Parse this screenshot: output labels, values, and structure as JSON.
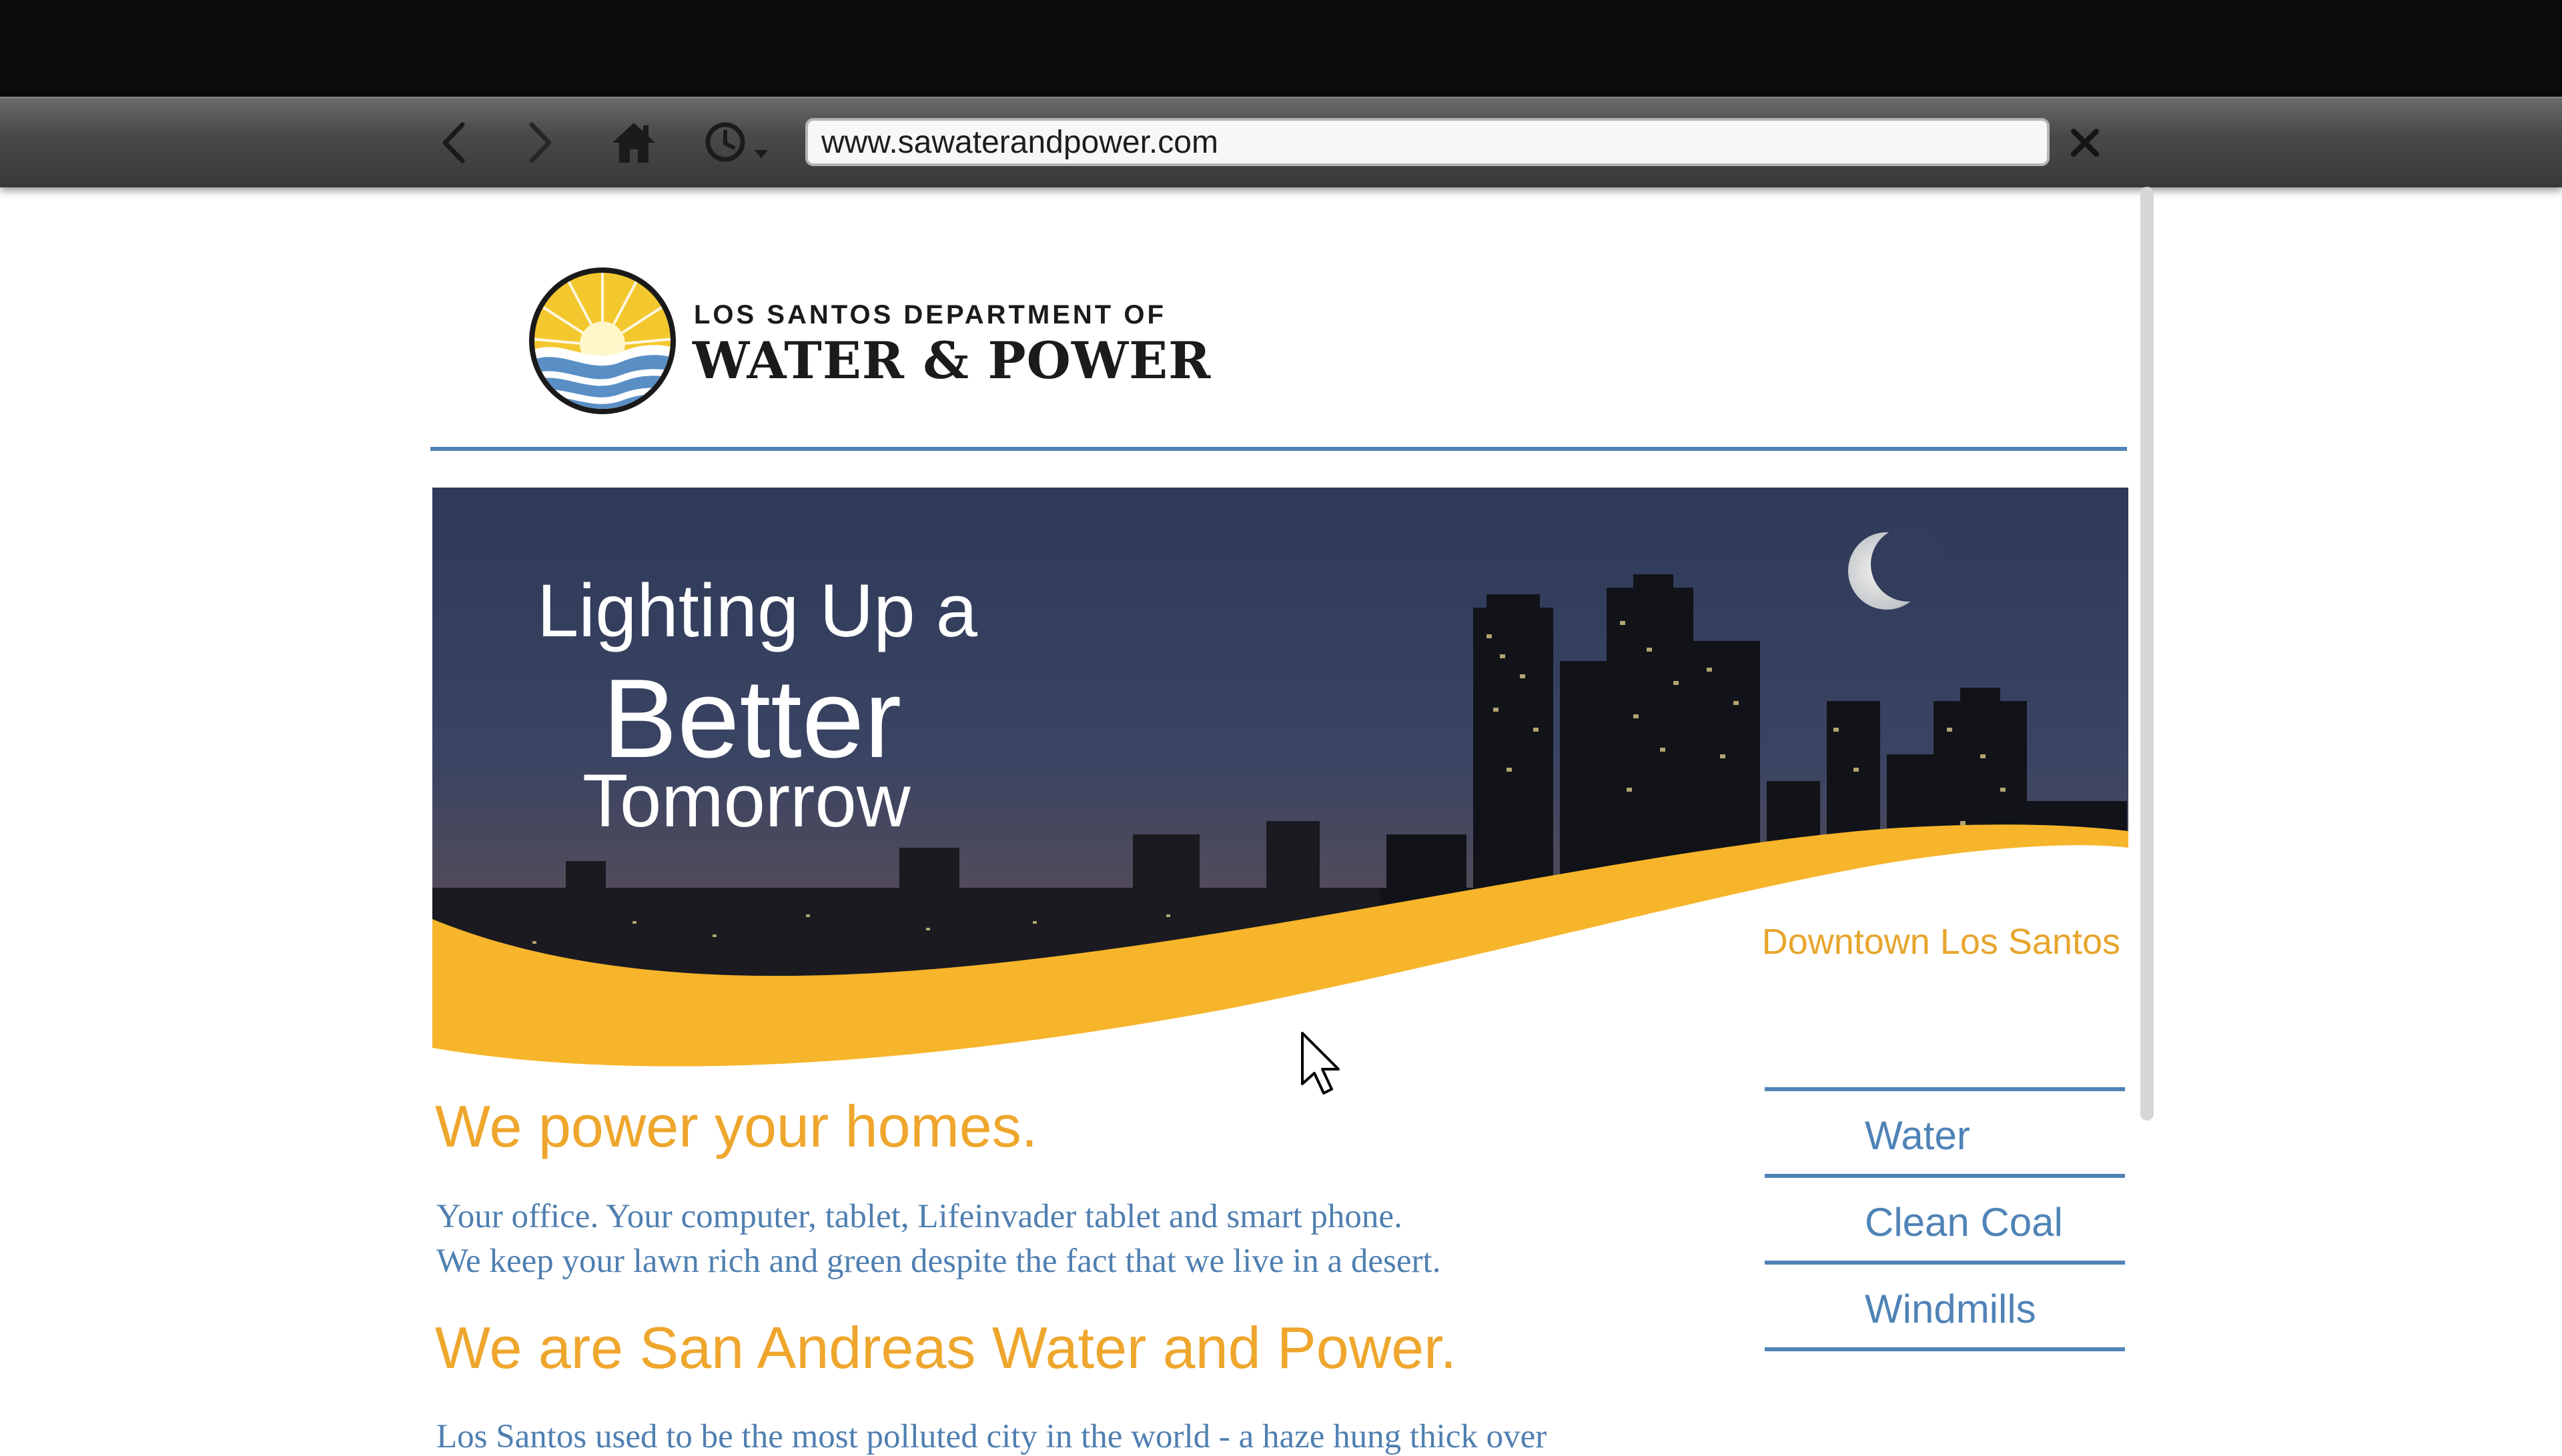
{
  "browser": {
    "url": "www.sawaterandpower.com",
    "back_icon": "chevron-left-icon",
    "forward_icon": "chevron-right-icon",
    "home_icon": "home-icon",
    "history_icon": "clock-icon",
    "close_icon": "close-icon"
  },
  "logo": {
    "line1": "LOS SANTOS DEPARTMENT OF",
    "line2": "WATER & POWER"
  },
  "banner": {
    "title_line1": "Lighting Up a",
    "title_line2": "Better",
    "title_line3": "Tomorrow",
    "caption": "Downtown Los Santos"
  },
  "content": {
    "heading1": "We power your homes.",
    "para1_line1": "Your office. Your computer, tablet, Lifeinvader tablet and smart phone.",
    "para1_line2": "We keep your lawn rich and green despite the fact that we live in a desert.",
    "heading2": "We are San Andreas Water and Power.",
    "para2_line1": "Los Santos used to be the most polluted city in the world - a haze hung thick over"
  },
  "sidebar": {
    "links": [
      "Water",
      "Clean Coal",
      "Windmills"
    ]
  },
  "colors": {
    "accent_orange": "#eea62c",
    "accent_blue": "#4f83b7",
    "banner_yellow": "#f6b52b"
  }
}
